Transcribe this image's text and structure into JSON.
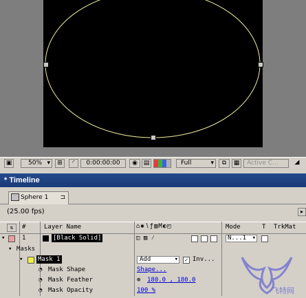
{
  "composition": {
    "zoom": "50%",
    "timecode": "0:00:00:00",
    "resolution": "Full",
    "camera": "Active C...",
    "colors": {
      "mask_path": "#f0f0a0",
      "canvas": "#000000",
      "pasteboard": "#7e7e7e"
    }
  },
  "timeline": {
    "panel_title": "* Timeline",
    "tab_label": "Sphere 1",
    "fps": "(25.00 fps)",
    "columns": {
      "index": "#",
      "layer_name": "Layer Name",
      "mode": "Mode",
      "t": "T",
      "trkmat": "TrkMat"
    },
    "layers": [
      {
        "number": "1",
        "name": "[Black Solid]",
        "mode": "N...1",
        "masks_label": "Masks",
        "mask": {
          "name": "Mask 1",
          "mode": "Add",
          "inverted_label": "Inv...",
          "properties": [
            {
              "name": "Mask Shape",
              "value": "Shape..."
            },
            {
              "name": "Mask Feather",
              "value": "180.0 , 180.0"
            },
            {
              "name": "Mask Opacity",
              "value": "100 %"
            }
          ]
        }
      }
    ]
  },
  "watermark": {
    "text": "飞特网"
  }
}
